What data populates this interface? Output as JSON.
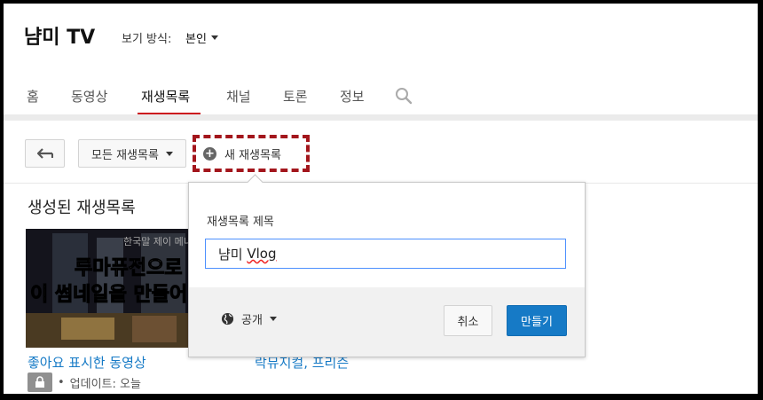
{
  "channel": {
    "title": "냠미 TV",
    "view_as_label": "보기 방식:",
    "view_as_value": "본인"
  },
  "tabs": [
    {
      "label": "홈",
      "active": false
    },
    {
      "label": "동영상",
      "active": false
    },
    {
      "label": "재생목록",
      "active": true
    },
    {
      "label": "채널",
      "active": false
    },
    {
      "label": "토론",
      "active": false
    },
    {
      "label": "정보",
      "active": false
    }
  ],
  "toolbar": {
    "all_playlists_label": "모든 재생목록",
    "new_playlist_label": "새 재생목록"
  },
  "section": {
    "title": "생성된 재생목록"
  },
  "playlists": {
    "liked": {
      "title": "좋아요 표시한 동영상",
      "update": "업데이트: 오늘",
      "thumb_line1": "루마퓨전으로",
      "thumb_line2": "이 썸네일을 만들어",
      "thumb_top": "한국말 제이 메니"
    },
    "other": {
      "title": "락뮤지컬, 프리즌"
    }
  },
  "popup": {
    "label": "재생목록 제목",
    "input_prefix": "냠미 ",
    "input_underlined": "Vlog",
    "privacy": "공개",
    "cancel": "취소",
    "create": "만들기"
  },
  "colors": {
    "accent_red": "#cc181e",
    "highlight_dashed": "#a3161c",
    "link_blue": "#167ac6",
    "button_blue": "#167ac6"
  }
}
